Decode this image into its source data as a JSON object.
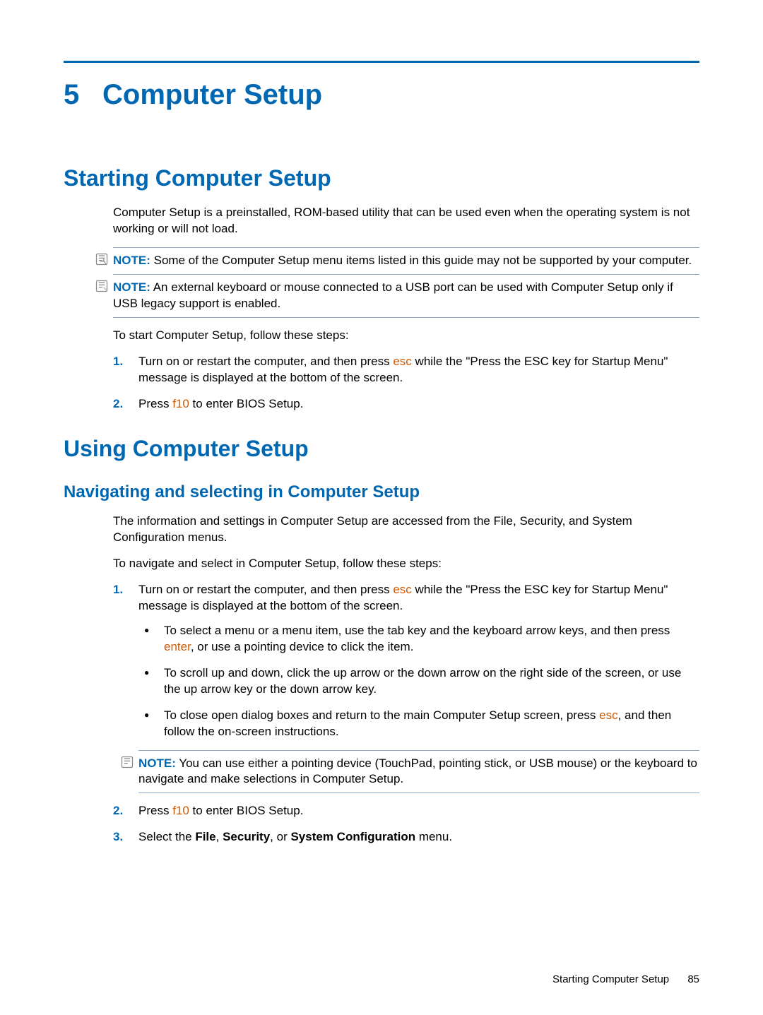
{
  "chapter": {
    "num": "5",
    "title": "Computer Setup"
  },
  "h2_starting": "Starting Computer Setup",
  "intro": "Computer Setup is a preinstalled, ROM-based utility that can be used even when the operating system is not working or will not load.",
  "note_label": "NOTE:",
  "note1": "Some of the Computer Setup menu items listed in this guide may not be supported by your computer.",
  "note2": "An external keyboard or mouse connected to a USB port can be used with Computer Setup only if USB legacy support is enabled.",
  "start_instr": "To start Computer Setup, follow these steps:",
  "steps_a": {
    "s1_a": "Turn on or restart the computer, and then press ",
    "s1_key": "esc",
    "s1_b": " while the \"Press the ESC key for Startup Menu\" message is displayed at the bottom of the screen.",
    "s2_a": "Press ",
    "s2_key": "f10",
    "s2_b": " to enter BIOS Setup."
  },
  "h2_using": "Using Computer Setup",
  "h3_nav": "Navigating and selecting in Computer Setup",
  "nav_p1": "The information and settings in Computer Setup are accessed from the File, Security, and System Configuration menus.",
  "nav_p2": "To navigate and select in Computer Setup, follow these steps:",
  "steps_b": {
    "s1_a": "Turn on or restart the computer, and then press ",
    "s1_key": "esc",
    "s1_b": " while the \"Press the ESC key for Startup Menu\" message is displayed at the bottom of the screen.",
    "b1_a": "To select a menu or a menu item, use the tab key and the keyboard arrow keys, and then press ",
    "b1_key": "enter",
    "b1_b": ", or use a pointing device to click the item.",
    "b2": "To scroll up and down, click the up arrow or the down arrow on the right side of the screen, or use the up arrow key or the down arrow key.",
    "b3_a": "To close open dialog boxes and return to the main Computer Setup screen, press ",
    "b3_key": "esc",
    "b3_b": ", and then follow the on-screen instructions.",
    "note3": "You can use either a pointing device (TouchPad, pointing stick, or USB mouse) or the keyboard to navigate and make selections in Computer Setup.",
    "s2_a": "Press ",
    "s2_key": "f10",
    "s2_b": " to enter BIOS Setup.",
    "s3_a": "Select the ",
    "s3_bold1": "File",
    "s3_mid1": ", ",
    "s3_bold2": "Security",
    "s3_mid2": ", or ",
    "s3_bold3": "System Configuration",
    "s3_b": " menu."
  },
  "footer_text": "Starting Computer Setup",
  "page_num": "85"
}
